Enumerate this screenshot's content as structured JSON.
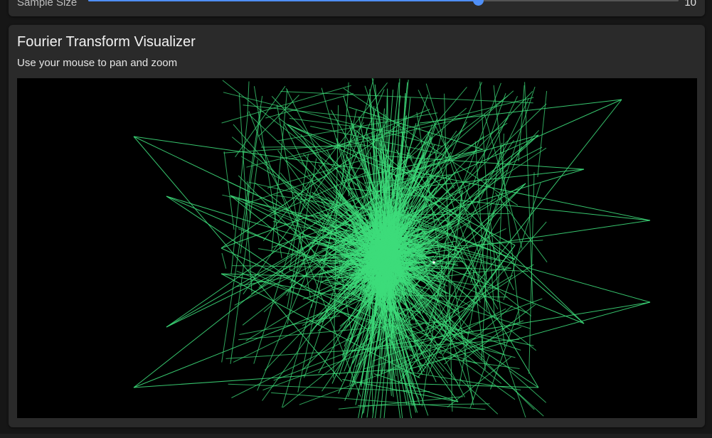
{
  "slider": {
    "label": "Sample Size",
    "value": "10",
    "fraction": 0.66,
    "accent_color": "#4f8ff7"
  },
  "visualizer": {
    "title": "Fourier Transform Visualizer",
    "subtitle": "Use your mouse to pan and zoom",
    "stroke_color": "#3ddc7a",
    "background_color": "#000000"
  }
}
